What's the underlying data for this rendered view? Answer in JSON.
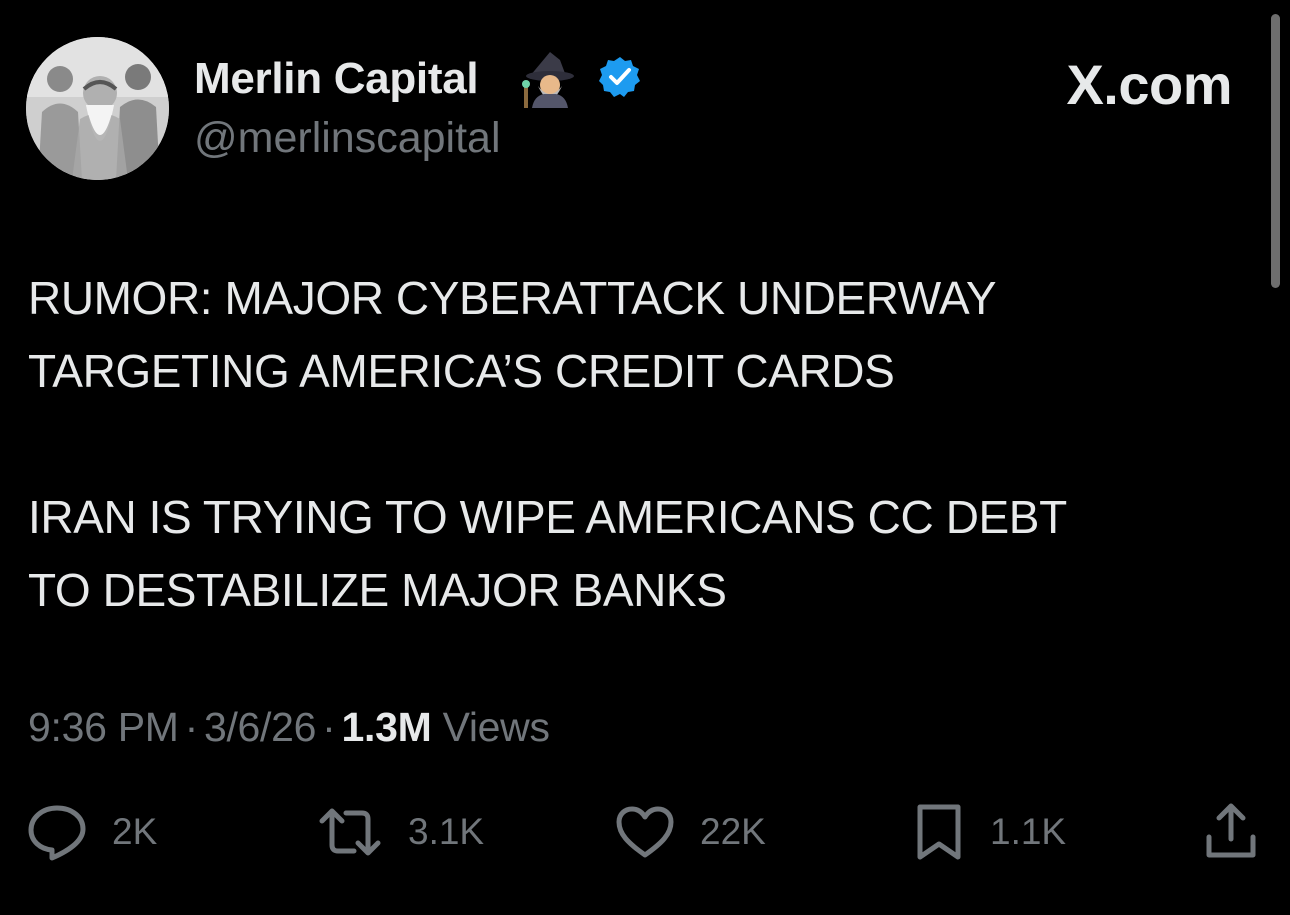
{
  "brand": "X.com",
  "author": {
    "display_name": "Merlin Capital",
    "handle": "@merlinscapital",
    "emoji_icon": "mage-emoji",
    "verified_icon": "verified-badge",
    "verified_color": "#1d9bf0"
  },
  "tweet": {
    "paragraphs": [
      [
        "RUMOR: MAJOR CYBERATTACK UNDERWAY",
        "TARGETING AMERICA’S CREDIT CARDS"
      ],
      [
        "IRAN IS TRYING TO WIPE AMERICANS CC DEBT",
        "TO DESTABILIZE MAJOR BANKS"
      ]
    ]
  },
  "meta": {
    "time": "9:36 PM",
    "separator": "·",
    "date": "3/6/26",
    "views_count": "1.3M",
    "views_label": "Views"
  },
  "actions": {
    "reply": {
      "icon": "reply-icon",
      "count": "2K"
    },
    "repost": {
      "icon": "repost-icon",
      "count": "3.1K"
    },
    "like": {
      "icon": "heart-icon",
      "count": "22K"
    },
    "bookmark": {
      "icon": "bookmark-icon",
      "count": "1.1K"
    },
    "share": {
      "icon": "share-icon"
    }
  },
  "colors": {
    "background": "#000000",
    "primary_text": "#e7e9ea",
    "secondary_text": "#71767b"
  }
}
